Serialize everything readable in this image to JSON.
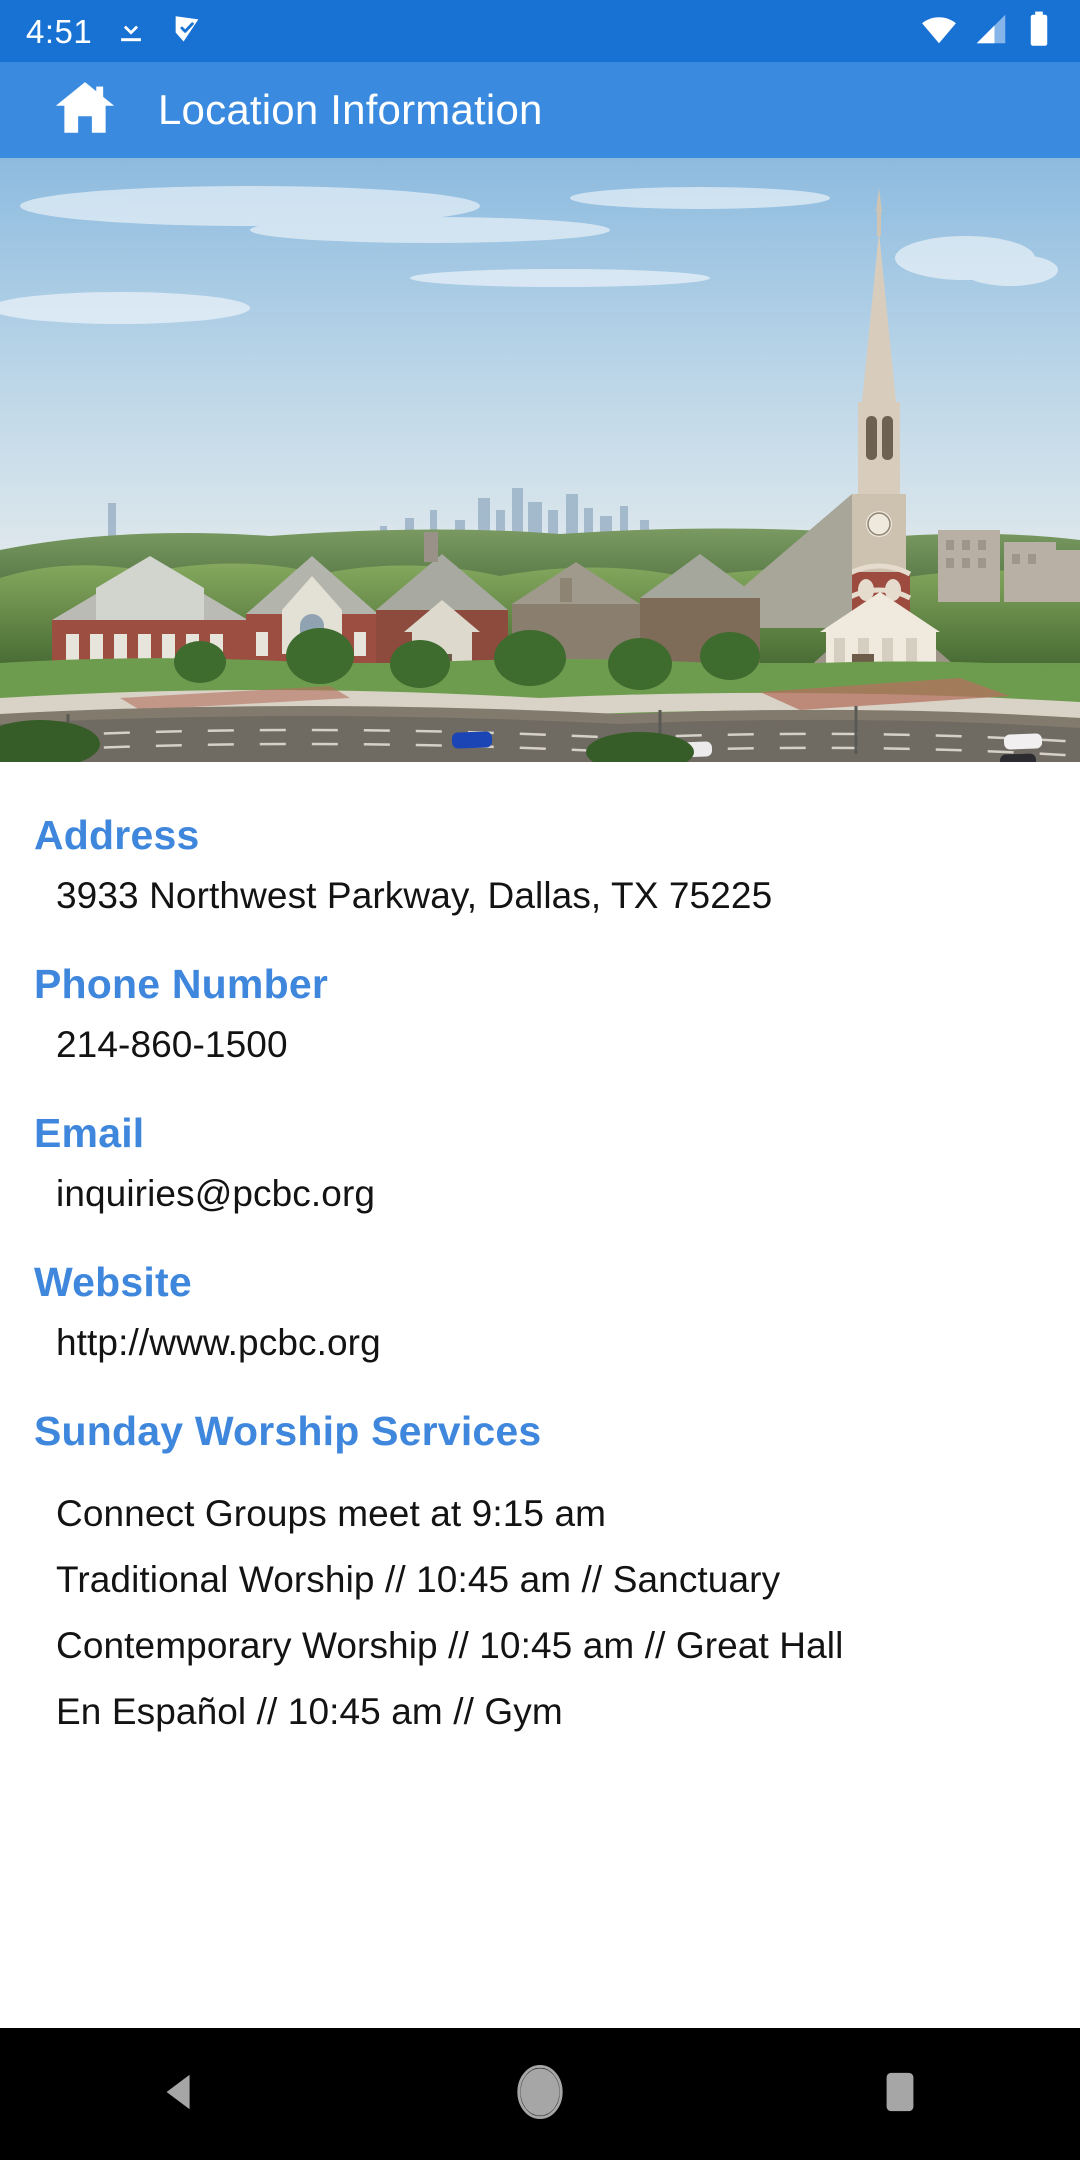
{
  "status_bar": {
    "time": "4:51",
    "icons_left": [
      "download-icon",
      "checkmark-flag-icon"
    ],
    "icons_right": [
      "wifi-icon",
      "cellular-signal-icon",
      "battery-icon"
    ],
    "background_color": "#1872d4",
    "foreground_color": "#ffffff"
  },
  "app_bar": {
    "title": "Location Information",
    "home_icon": "home-icon",
    "background_color": "#3a8ae0",
    "title_color": "#ffffff"
  },
  "hero": {
    "alt": "Aerial photo of church campus with steeple, trees and Dallas skyline"
  },
  "theme": {
    "heading_color": "#3f87dc",
    "body_color": "#131313",
    "page_background": "#ffffff"
  },
  "sections": [
    {
      "heading": "Address",
      "value": "3933 Northwest Parkway, Dallas, TX 75225"
    },
    {
      "heading": "Phone Number",
      "value": "214-860-1500"
    },
    {
      "heading": "Email",
      "value": "inquiries@pcbc.org"
    },
    {
      "heading": "Website",
      "value": "http://www.pcbc.org"
    }
  ],
  "services": {
    "heading": "Sunday Worship Services",
    "lines": [
      "Connect Groups meet at 9:15 am",
      "Traditional Worship // 10:45 am // Sanctuary",
      "Contemporary Worship // 10:45 am // Great Hall",
      "En Español // 10:45 am // Gym"
    ]
  },
  "nav_bar": {
    "background_color": "#000000",
    "buttons": [
      {
        "name": "back-button",
        "icon": "triangle-left-icon"
      },
      {
        "name": "home-button",
        "icon": "circle-icon"
      },
      {
        "name": "recents-button",
        "icon": "square-icon"
      }
    ]
  }
}
